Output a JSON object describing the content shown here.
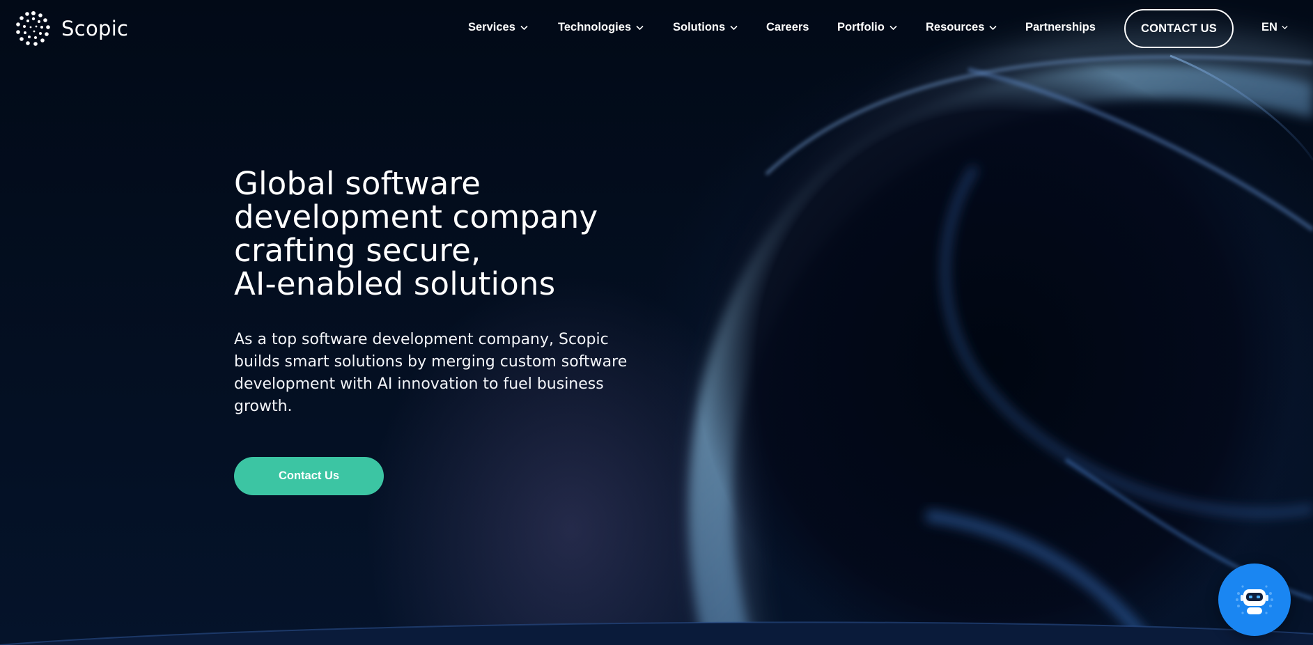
{
  "brand": {
    "name": "Scopic",
    "logo_icon": "dotted-ring-logo-icon"
  },
  "nav": {
    "items": [
      {
        "label": "Services",
        "has_dropdown": true
      },
      {
        "label": "Technologies",
        "has_dropdown": true
      },
      {
        "label": "Solutions",
        "has_dropdown": true
      },
      {
        "label": "Careers",
        "has_dropdown": false
      },
      {
        "label": "Portfolio",
        "has_dropdown": true
      },
      {
        "label": "Resources",
        "has_dropdown": true
      },
      {
        "label": "Partnerships",
        "has_dropdown": false
      }
    ],
    "contact_label": "CONTACT US",
    "language": "EN"
  },
  "hero": {
    "title_lines": [
      "Global software",
      "development company",
      "crafting secure,",
      "AI-enabled solutions"
    ],
    "description": "As a top software development company, Scopic builds smart solutions by merging custom software development with AI innovation to fuel business growth.",
    "cta_label": "Contact Us"
  },
  "chat_widget": {
    "icon": "robot-chat-icon"
  },
  "colors": {
    "background": "#040d1c",
    "cta": "#3cc5a3",
    "chat": "#1a86f2",
    "text": "#ffffff"
  }
}
